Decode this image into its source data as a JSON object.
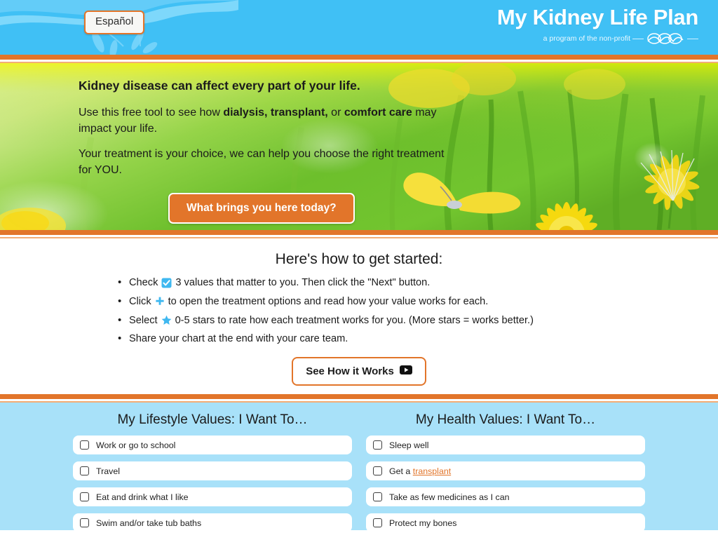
{
  "header": {
    "language_button": "Español",
    "title": "My Kidney Life Plan",
    "tagline": "a program of the non-profit",
    "logo_name": "mei",
    "brand_blue": "#40c0f5",
    "accent_orange": "#e2752a"
  },
  "hero": {
    "heading": "Kidney disease can affect every part of your life.",
    "paragraph1_pre": "Use this free tool to see how ",
    "paragraph1_bold1": "dialysis, transplant,",
    "paragraph1_mid": " or ",
    "paragraph1_bold2": "comfort care",
    "paragraph1_post": " may impact your life.",
    "paragraph2": "Your treatment is your choice, we can help you choose the right treatment for YOU.",
    "cta_button": "What brings you here today?"
  },
  "get_started": {
    "heading": "Here's how to get started:",
    "steps": [
      {
        "pre": "Check ",
        "icon": "checked-checkbox-icon",
        "post": "3 values that matter to you. Then click the \"Next\" button."
      },
      {
        "pre": "Click ",
        "icon": "plus-icon",
        "post": "to open the treatment options and read how your value works for each."
      },
      {
        "pre": "Select ",
        "icon": "star-icon",
        "post": "0-5 stars to rate how each treatment works for you. (More stars = works better.)"
      },
      {
        "pre": "Share your chart at the end with your care team.",
        "icon": null,
        "post": ""
      }
    ],
    "video_button": "See How it Works",
    "video_icon": "play-video-icon"
  },
  "values": {
    "lifestyle": {
      "heading": "My Lifestyle Values: I Want To…",
      "items": [
        {
          "label": "Work or go to school",
          "checked": false
        },
        {
          "label": "Travel",
          "checked": false
        },
        {
          "label": "Eat and drink what I like",
          "checked": false
        },
        {
          "label": "Swim and/or take tub baths",
          "checked": false
        }
      ]
    },
    "health": {
      "heading": "My Health Values: I Want To…",
      "items": [
        {
          "label": "Sleep well",
          "checked": false,
          "link": null
        },
        {
          "label": "Get a ",
          "checked": false,
          "link": "transplant"
        },
        {
          "label": "Take as few medicines as I can",
          "checked": false,
          "link": null
        },
        {
          "label": "Protect my bones",
          "checked": false,
          "link": null
        }
      ]
    }
  }
}
